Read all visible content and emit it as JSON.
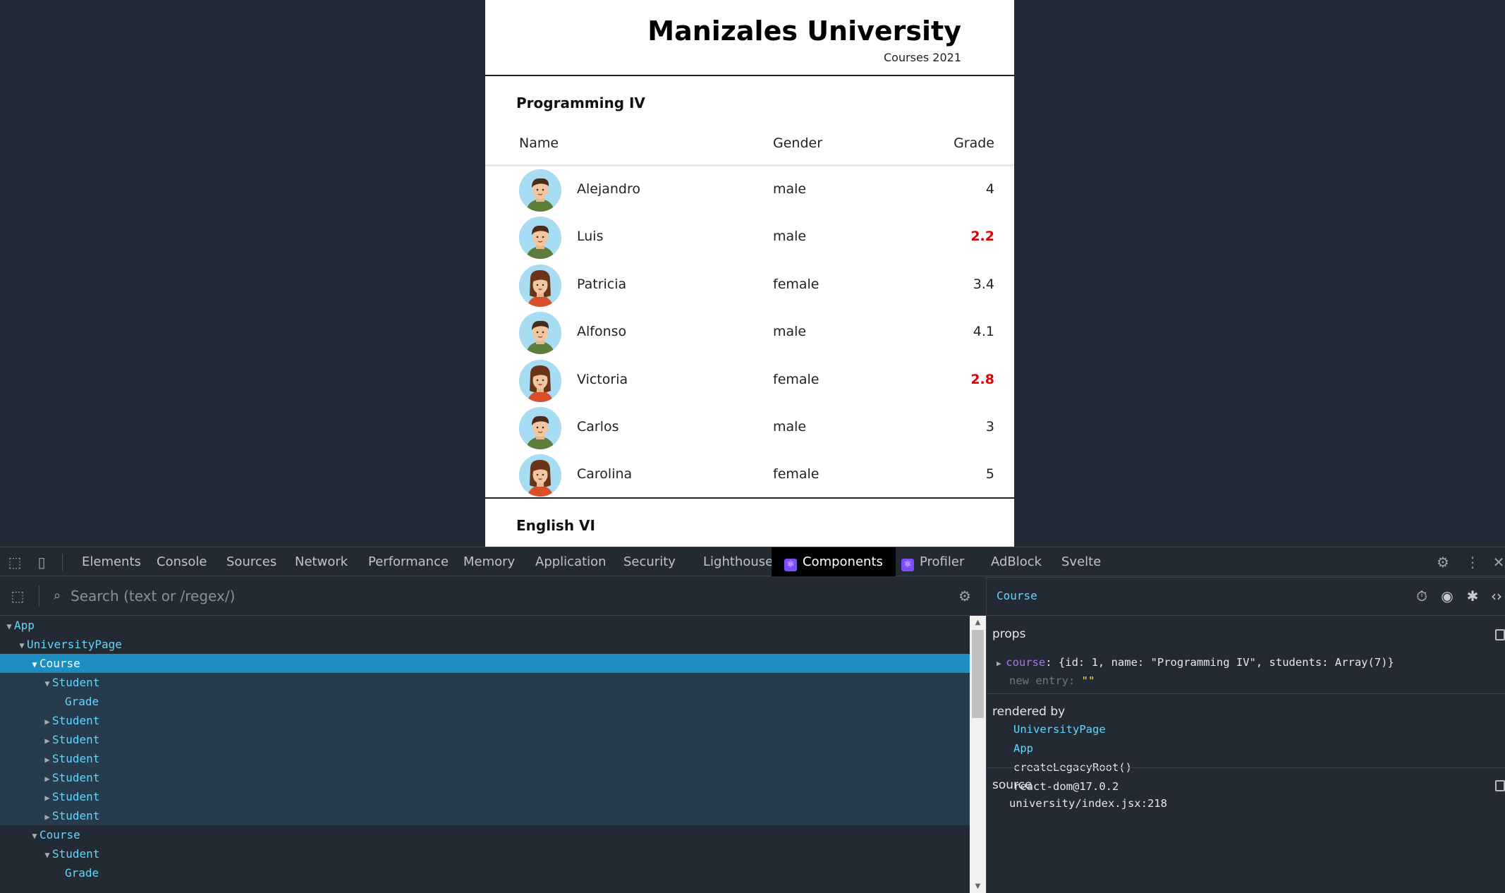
{
  "page": {
    "title": "Manizales University",
    "subtitle": "Courses 2021",
    "courses": [
      {
        "title": "Programming IV",
        "headers": {
          "name": "Name",
          "gender": "Gender",
          "grade": "Grade"
        },
        "students": [
          {
            "name": "Alejandro",
            "gender": "male",
            "grade": "4",
            "failing": false
          },
          {
            "name": "Luis",
            "gender": "male",
            "grade": "2.2",
            "failing": true
          },
          {
            "name": "Patricia",
            "gender": "female",
            "grade": "3.4",
            "failing": false
          },
          {
            "name": "Alfonso",
            "gender": "male",
            "grade": "4.1",
            "failing": false
          },
          {
            "name": "Victoria",
            "gender": "female",
            "grade": "2.8",
            "failing": true
          },
          {
            "name": "Carlos",
            "gender": "male",
            "grade": "3",
            "failing": false
          },
          {
            "name": "Carolina",
            "gender": "female",
            "grade": "5",
            "failing": false
          }
        ]
      },
      {
        "title": "English VI"
      }
    ]
  },
  "devtools": {
    "tabs": [
      "Elements",
      "Console",
      "Sources",
      "Network",
      "Performance",
      "Memory",
      "Application",
      "Security",
      "Lighthouse",
      "Components",
      "Profiler",
      "AdBlock",
      "Svelte"
    ],
    "active_tab": "Components",
    "search_placeholder": "Search (text or /regex/)",
    "tree": [
      {
        "label": "App",
        "arrow": "down"
      },
      {
        "label": "UniversityPage",
        "arrow": "down"
      },
      {
        "label": "Course",
        "arrow": "down",
        "state": "selected"
      },
      {
        "label": "Student",
        "arrow": "down",
        "state": "child"
      },
      {
        "label": "Grade",
        "arrow": "",
        "state": "child"
      },
      {
        "label": "Student",
        "arrow": "right",
        "state": "child"
      },
      {
        "label": "Student",
        "arrow": "right",
        "state": "child"
      },
      {
        "label": "Student",
        "arrow": "right",
        "state": "child"
      },
      {
        "label": "Student",
        "arrow": "right",
        "state": "child"
      },
      {
        "label": "Student",
        "arrow": "right",
        "state": "child"
      },
      {
        "label": "Student",
        "arrow": "right",
        "state": "child"
      },
      {
        "label": "Course",
        "arrow": "down"
      },
      {
        "label": "Student",
        "arrow": "down"
      },
      {
        "label": "Grade",
        "arrow": ""
      }
    ],
    "inspector": {
      "component": "Course",
      "props_title": "props",
      "prop_key": "course",
      "prop_value": "{id: 1, name: \"Programming IV\", students: Array(7)}",
      "new_entry_label": "new entry",
      "new_entry_value": "\"\"",
      "rendered_by_title": "rendered by",
      "rendered_by": [
        "UniversityPage",
        "App",
        "createLegacyRoot()",
        "react-dom@17.0.2"
      ],
      "source_title": "source",
      "source": "university/index.jsx:218"
    }
  },
  "colors": {
    "failing_grade": "#e00000",
    "component_name": "#61d6fb",
    "selected_row": "#1c8fc0"
  }
}
